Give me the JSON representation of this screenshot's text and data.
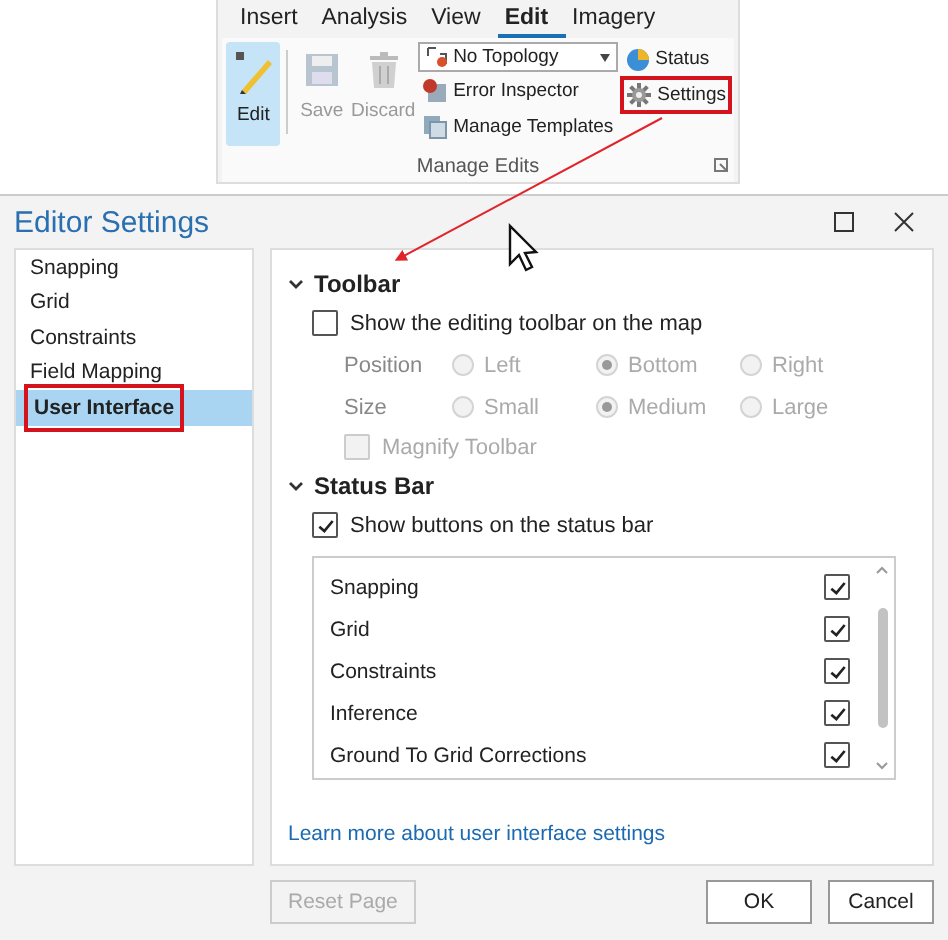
{
  "ribbon": {
    "tabs": [
      {
        "label": "Insert",
        "selected": false
      },
      {
        "label": "Analysis",
        "selected": false
      },
      {
        "label": "View",
        "selected": false
      },
      {
        "label": "Edit",
        "selected": true
      },
      {
        "label": "Imagery",
        "selected": false
      }
    ],
    "large_buttons": [
      {
        "label": "Edit",
        "selected": true,
        "disabled": false
      },
      {
        "label": "Save",
        "selected": false,
        "disabled": true
      },
      {
        "label": "Discard",
        "selected": false,
        "disabled": true
      }
    ],
    "topology_dropdown": {
      "value": "No Topology"
    },
    "commands": [
      {
        "label": "Error Inspector",
        "highlighted": false
      },
      {
        "label": "Manage Templates",
        "highlighted": false
      }
    ],
    "side_commands": [
      {
        "label": "Status",
        "highlighted": false
      },
      {
        "label": "Settings",
        "highlighted": true
      }
    ],
    "group_label": "Manage Edits"
  },
  "dialog": {
    "title": "Editor Settings",
    "nav_items": [
      {
        "label": "Snapping",
        "selected": false,
        "highlighted": false
      },
      {
        "label": "Grid",
        "selected": false,
        "highlighted": false
      },
      {
        "label": "Constraints",
        "selected": false,
        "highlighted": false
      },
      {
        "label": "Field Mapping",
        "selected": false,
        "highlighted": false
      },
      {
        "label": "User Interface",
        "selected": true,
        "highlighted": true
      }
    ],
    "sections": [
      {
        "title": "Toolbar",
        "expanded": true,
        "items": [
          {
            "kind": "checkbox",
            "label": "Show the editing toolbar on the map",
            "checked": false,
            "disabled": false
          },
          {
            "kind": "radio",
            "label": "Position",
            "disabled": true,
            "options": [
              {
                "label": "Left",
                "selected": false
              },
              {
                "label": "Bottom",
                "selected": true
              },
              {
                "label": "Right",
                "selected": false
              }
            ]
          },
          {
            "kind": "radio",
            "label": "Size",
            "disabled": true,
            "options": [
              {
                "label": "Small",
                "selected": false
              },
              {
                "label": "Medium",
                "selected": true
              },
              {
                "label": "Large",
                "selected": false
              }
            ]
          },
          {
            "kind": "subcheckbox",
            "label": "Magnify Toolbar",
            "checked": false,
            "disabled": true
          }
        ]
      },
      {
        "title": "Status Bar",
        "expanded": true,
        "items": [
          {
            "kind": "checkbox",
            "label": "Show buttons on the status bar",
            "checked": true,
            "disabled": false
          },
          {
            "kind": "list",
            "rows": [
              {
                "label": "Snapping",
                "checked": true
              },
              {
                "label": "Grid",
                "checked": true
              },
              {
                "label": "Constraints",
                "checked": true
              },
              {
                "label": "Inference",
                "checked": true
              },
              {
                "label": "Ground To Grid Corrections",
                "checked": true
              }
            ]
          }
        ]
      }
    ],
    "link": "Learn more about user interface settings",
    "buttons": [
      {
        "label": "Reset Page",
        "disabled": true
      },
      {
        "label": "OK",
        "disabled": false
      },
      {
        "label": "Cancel",
        "disabled": false
      }
    ]
  }
}
